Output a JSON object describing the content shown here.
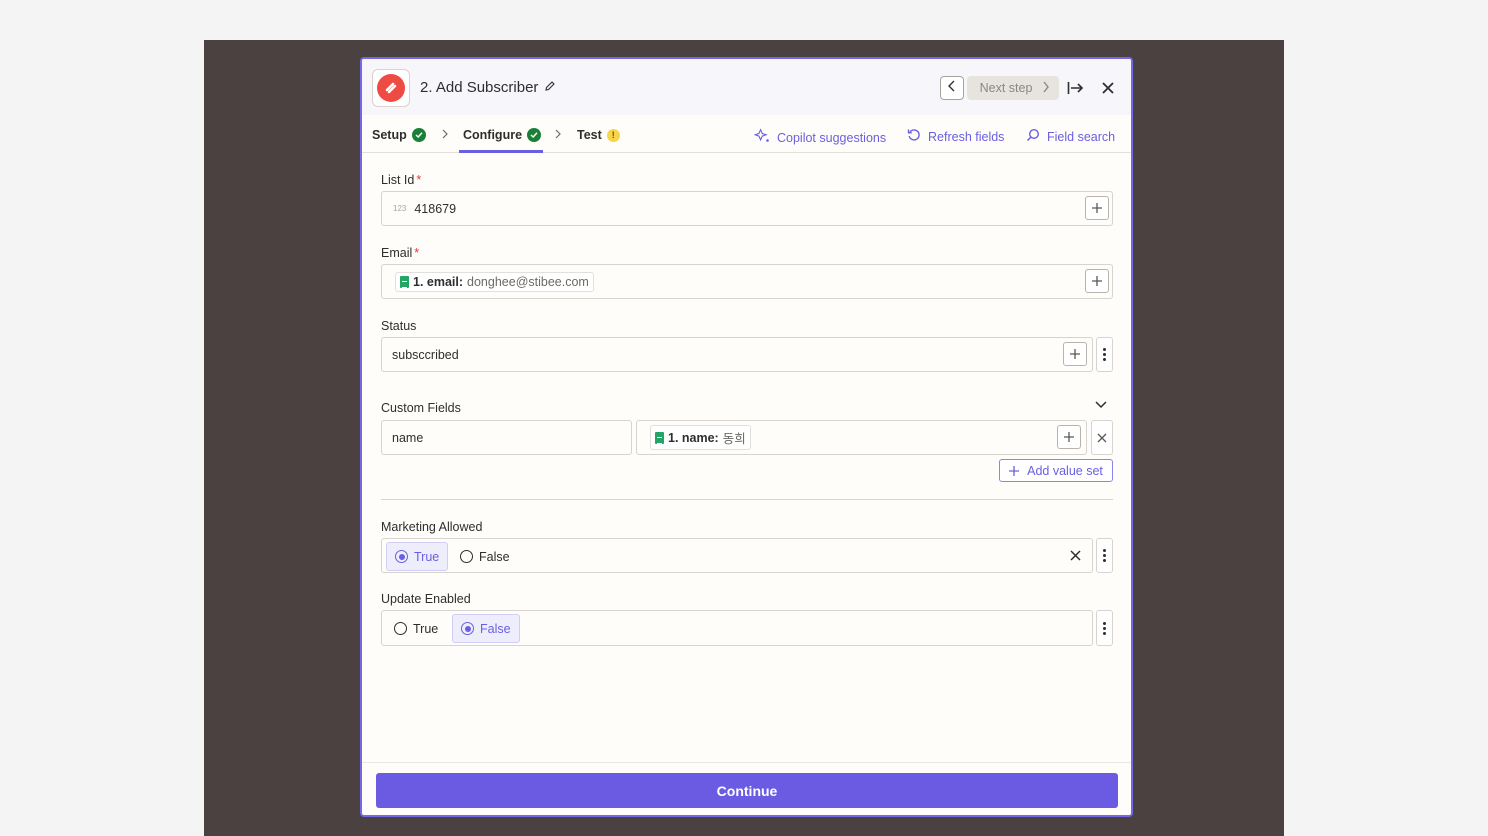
{
  "header": {
    "step_title": "2. Add Subscriber",
    "next_step_label": "Next step"
  },
  "tabs": [
    {
      "label": "Setup",
      "status": "complete"
    },
    {
      "label": "Configure",
      "status": "complete"
    },
    {
      "label": "Test",
      "status": "warning",
      "badge": "!"
    }
  ],
  "actions": {
    "copilot": "Copilot suggestions",
    "refresh": "Refresh fields",
    "field_search": "Field search"
  },
  "fields": {
    "list_id": {
      "label": "List Id",
      "required": "*",
      "type_hint": "123",
      "value": "418679"
    },
    "email": {
      "label": "Email",
      "required": "*",
      "pill_key": "1. email:",
      "pill_value": "donghee@stibee.com"
    },
    "status": {
      "label": "Status",
      "value": "subsccribed"
    },
    "custom_fields": {
      "label": "Custom Fields",
      "key": "name",
      "pill_key": "1. name:",
      "pill_value": "동희",
      "add_value_set": "Add value set"
    },
    "marketing_allowed": {
      "label": "Marketing Allowed",
      "options": [
        "True",
        "False"
      ],
      "selected": "True"
    },
    "update_enabled": {
      "label": "Update Enabled",
      "options": [
        "True",
        "False"
      ],
      "selected": "False"
    }
  },
  "footer": {
    "continue_label": "Continue"
  },
  "colors": {
    "accent": "#6a5fe0",
    "success": "#1a7f37",
    "warning": "#f8d548",
    "brand": "#ef4b45"
  }
}
